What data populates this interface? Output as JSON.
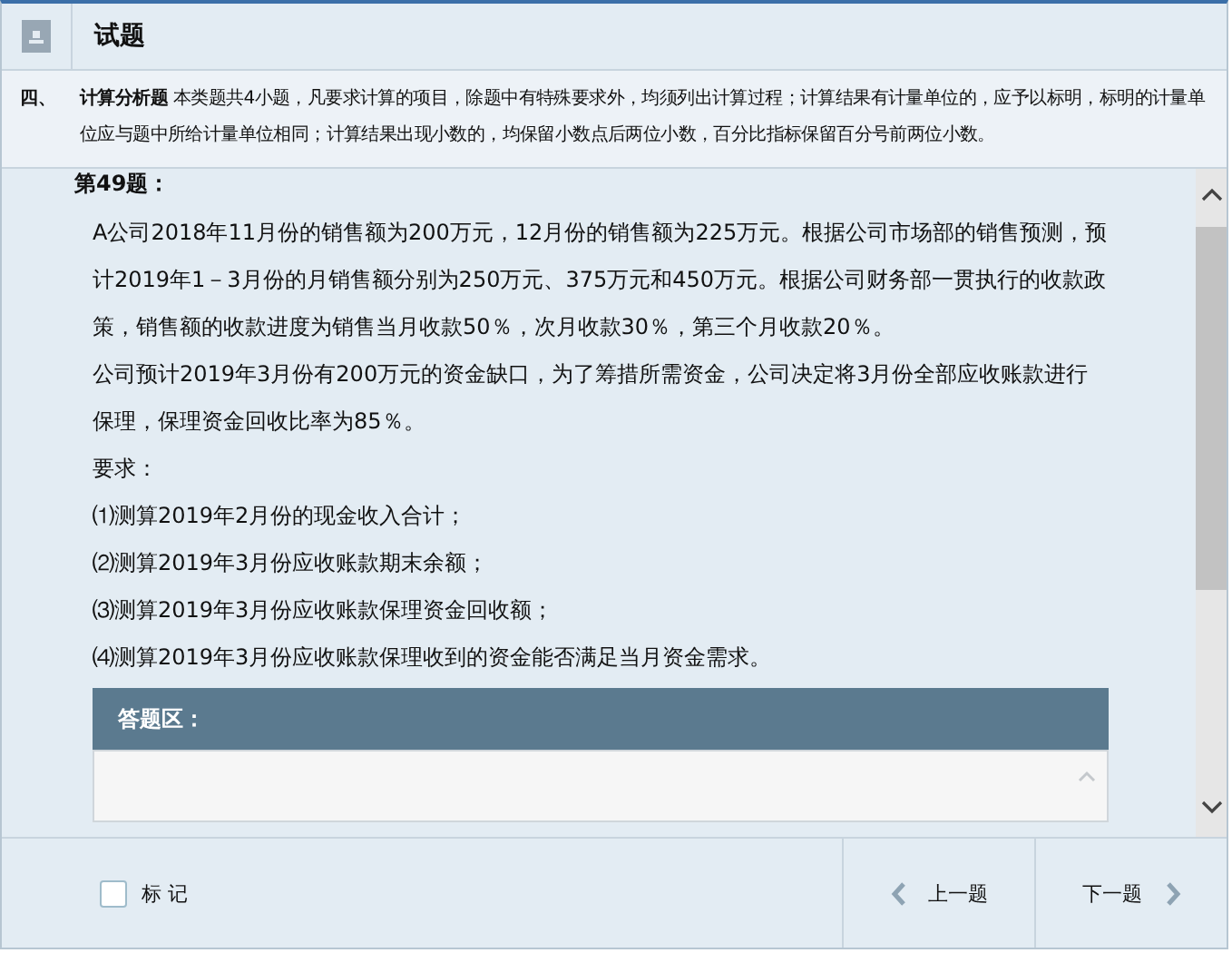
{
  "header": {
    "title": "试题"
  },
  "section": {
    "number": "四、",
    "name": "计算分析题",
    "instructions": "本类题共4小题，凡要求计算的项目，除题中有特殊要求外，均须列出计算过程；计算结果有计量单位的，应予以标明，标明的计量单位应与题中所给计量单位相同；计算结果出现小数的，均保留小数点后两位小数，百分比指标保留百分号前两位小数。"
  },
  "question": {
    "number": "第49题：",
    "paragraphs": [
      "A公司2018年11月份的销售额为200万元，12月份的销售额为225万元。根据公司市场部的销售预测，预计2019年1－3月份的月销售额分别为250万元、375万元和450万元。根据公司财务部一贯执行的收款政策，销售额的收款进度为销售当月收款50％，次月收款30％，第三个月收款20％。",
      "公司预计2019年3月份有200万元的资金缺口，为了筹措所需资金，公司决定将3月份全部应收账款进行保理，保理资金回收比率为85％。",
      "要求：",
      "⑴测算2019年2月份的现金收入合计；",
      "⑵测算2019年3月份应收账款期末余额；",
      "⑶测算2019年3月份应收账款保理资金回收额；",
      "⑷测算2019年3月份应收账款保理收到的资金能否满足当月资金需求。"
    ]
  },
  "answer": {
    "title": "答题区："
  },
  "footer": {
    "mark": {
      "label": "标 记",
      "checked": false
    },
    "prev": "上一题",
    "next": "下一题"
  }
}
